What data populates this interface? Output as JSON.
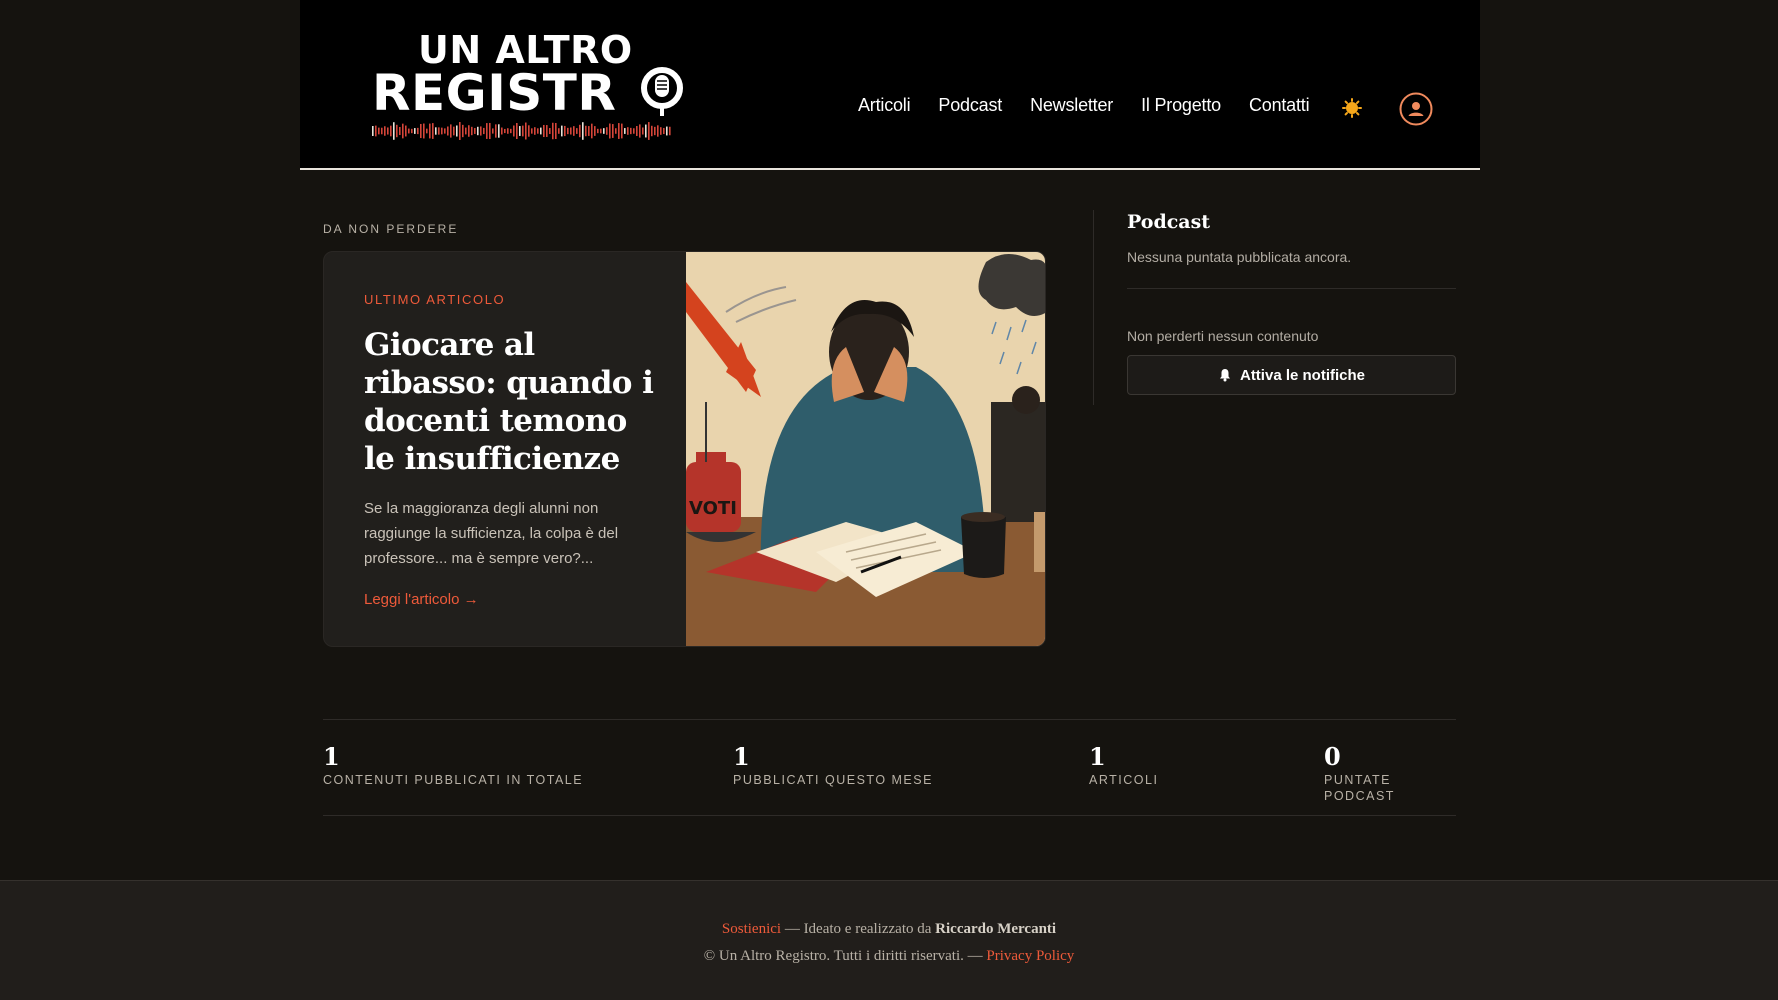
{
  "header": {
    "logo_line1": "UN ALTRO",
    "logo_line2": "REGISTR",
    "nav": [
      "Articoli",
      "Podcast",
      "Newsletter",
      "Il Progetto",
      "Contatti"
    ],
    "theme_icon": "sun-icon",
    "account_icon": "user-circle-icon"
  },
  "main": {
    "section_label": "DA NON PERDERE",
    "hero": {
      "kicker": "ULTIMO ARTICOLO",
      "title": "Giocare al ribasso: quando i docenti temono le insufficienze",
      "excerpt": "Se la maggioranza degli alunni non raggiunge la sufficienza, la colpa è del professore... ma è sempre vero?...",
      "link": "Leggi l'articolo →",
      "image_label": "VOTI"
    }
  },
  "sidebar": {
    "title": "Podcast",
    "empty": "Nessuna puntata pubblicata ancora.",
    "subtitle": "Non perderti nessun contenuto",
    "button": "Attiva le notifiche"
  },
  "stats": [
    {
      "value": "1",
      "label": "CONTENUTI PUBBLICATI IN TOTALE"
    },
    {
      "value": "1",
      "label": "PUBBLICATI QUESTO MESE"
    },
    {
      "value": "1",
      "label": "ARTICOLI"
    },
    {
      "value": "0",
      "label": "PUNTATE PODCAST"
    }
  ],
  "footer": {
    "support": "Sostienici",
    "credit_prefix": " — Ideato e realizzato da ",
    "author": "Riccardo Mercanti",
    "copyright": "© Un Altro Registro. Tutti i diritti riservati. — ",
    "privacy": "Privacy Policy"
  },
  "colors": {
    "accent": "#ee5a3a",
    "background": "#15130f",
    "card": "#211f1c"
  }
}
